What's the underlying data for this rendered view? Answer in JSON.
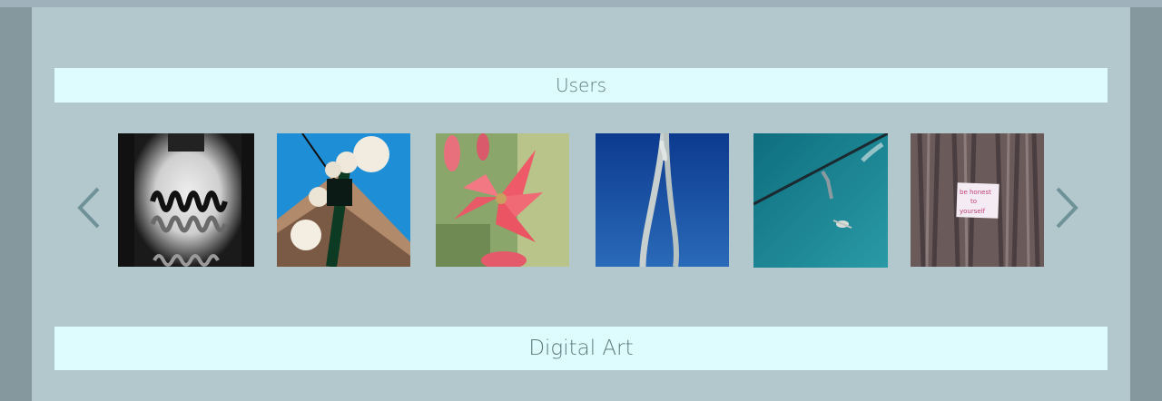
{
  "sections": {
    "users_title": "Users",
    "digital_art_title": "Digital Art"
  },
  "gallery": {
    "prev_icon": "chevron-left-icon",
    "next_icon": "chevron-right-icon",
    "thumbnails": [
      {
        "subject": "abstract-bw-squiggle"
      },
      {
        "subject": "street-lamp-globes"
      },
      {
        "subject": "pink-flower"
      },
      {
        "subject": "knotted-rope-blue-sky"
      },
      {
        "subject": "wire-with-bird-teal-sky"
      },
      {
        "subject": "tree-bark-with-note"
      }
    ],
    "note_text": "be honest to yourself"
  },
  "colors": {
    "background": "#84989d",
    "panel": "#b3c8cc",
    "section_bar": "#defbfe",
    "section_text": "#5f7a80",
    "arrow": "#6f9198"
  }
}
